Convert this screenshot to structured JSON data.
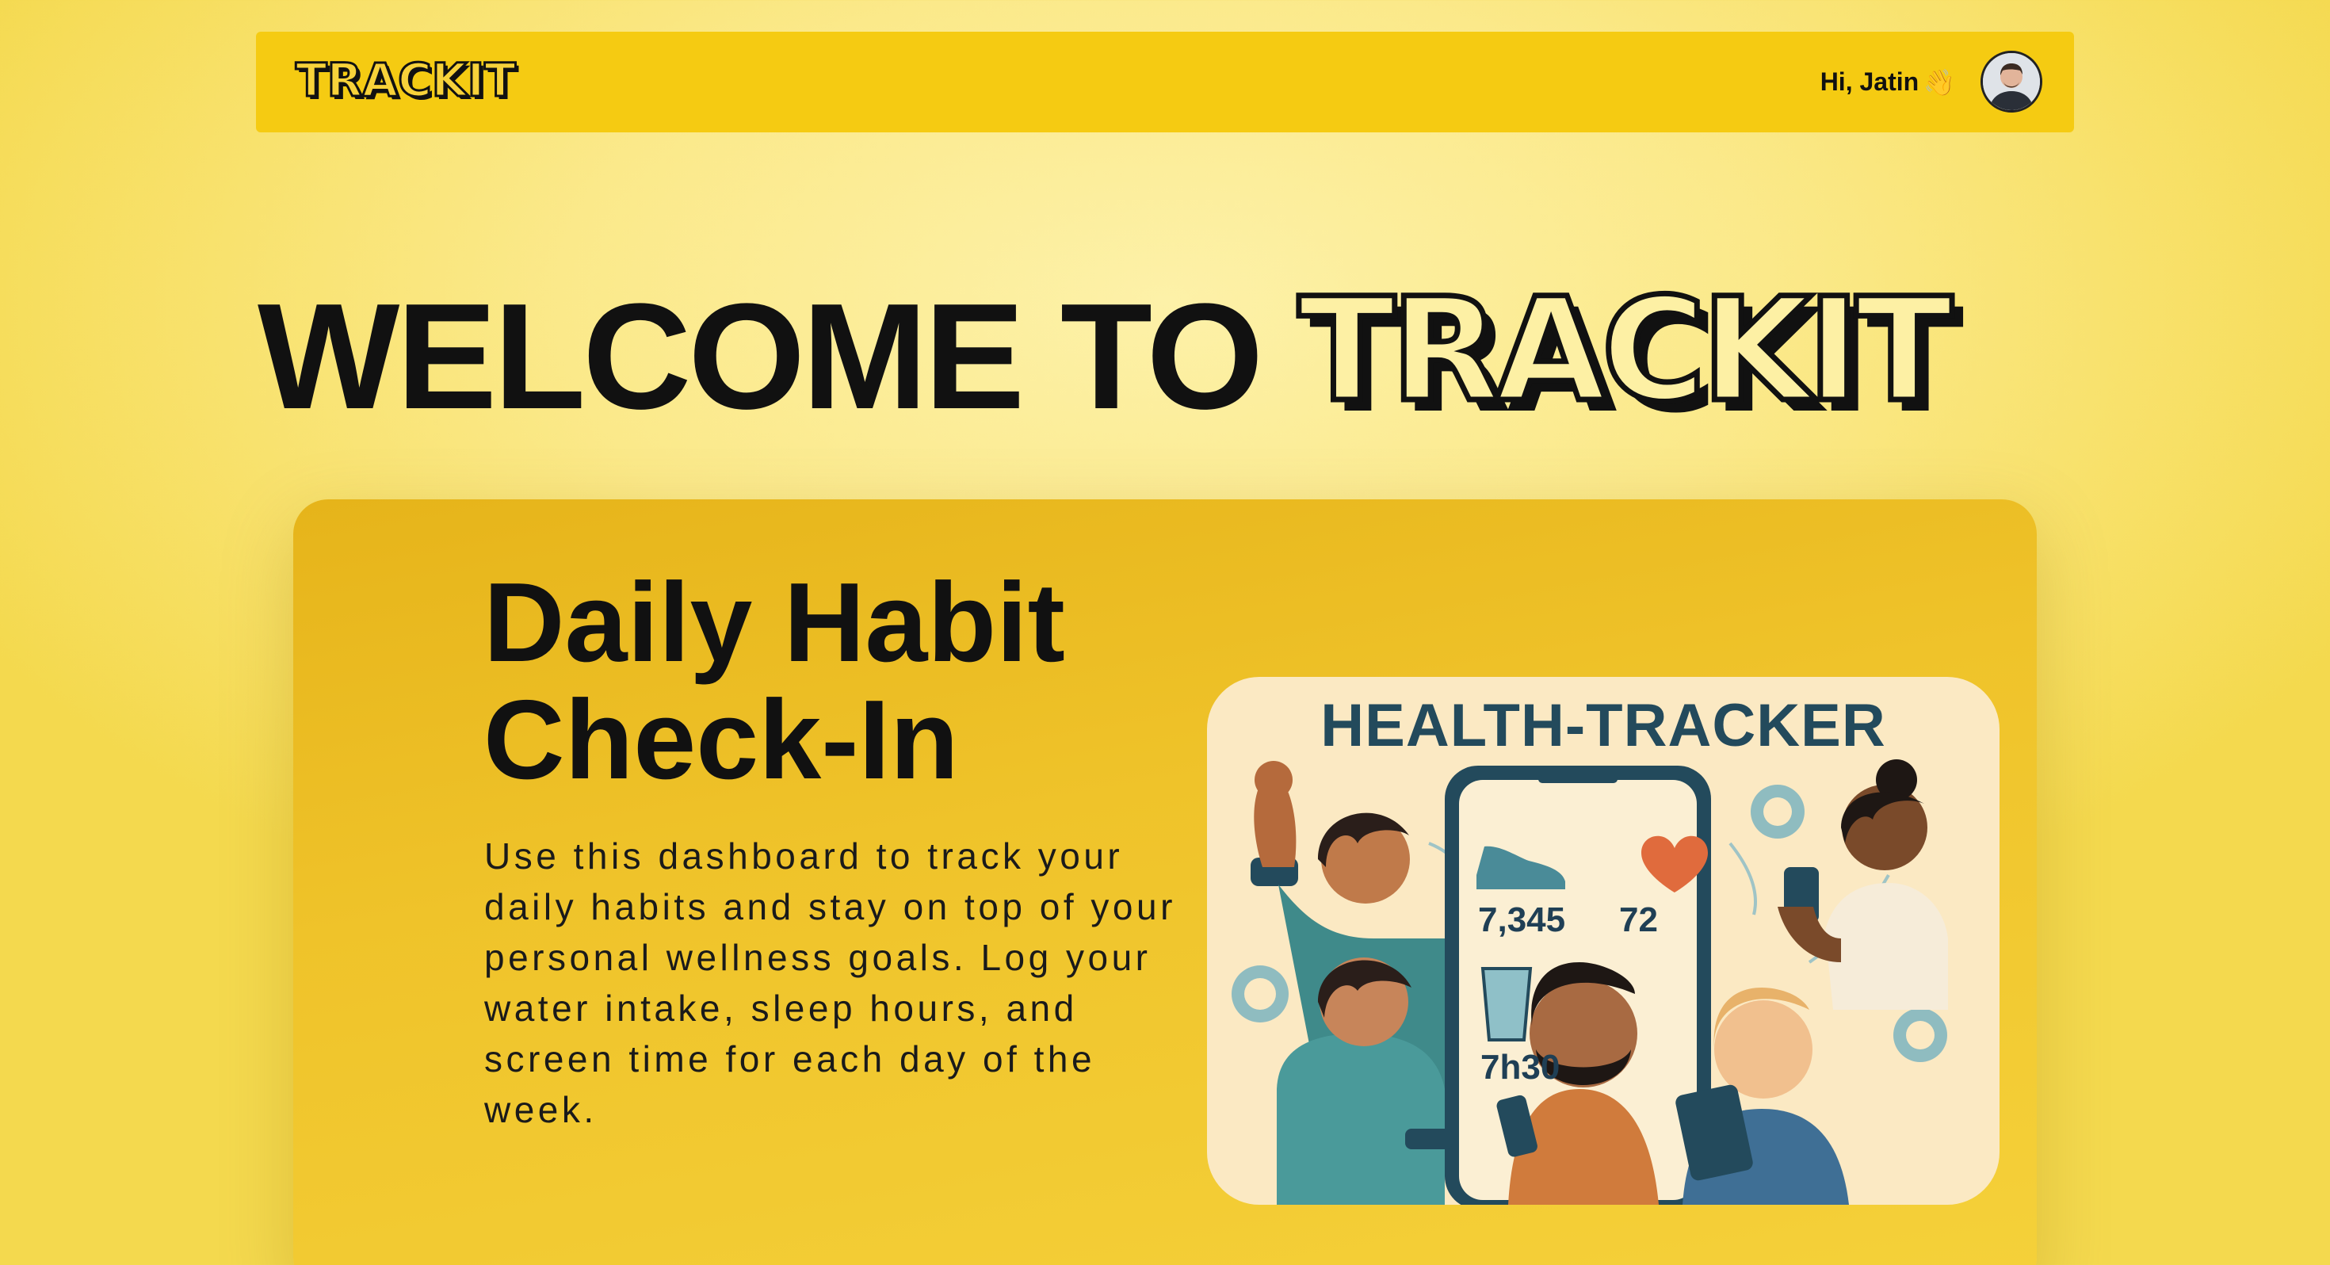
{
  "app": {
    "brand": "TRACKIT"
  },
  "navbar": {
    "logo_text": "TRACKIT",
    "greeting": "Hi, Jatin",
    "greeting_emoji": "👋"
  },
  "hero": {
    "prefix": "WELCOME TO",
    "brand": "TRACKIT"
  },
  "card": {
    "title": "Daily Habit Check-In",
    "description": "Use this dashboard to track your daily habits and stay on top of your personal wellness goals. Log your water intake, sleep hours, and screen time for each day of the week."
  },
  "illustration": {
    "title": "HEALTH-TRACKER",
    "steps": "7,345",
    "heart_rate": "72",
    "sleep": "7h30"
  },
  "colors": {
    "navbar": "#f5cb12",
    "card": "#efc32a",
    "illustration_bg": "#fbe9c3",
    "title_teal": "#234a5c"
  }
}
